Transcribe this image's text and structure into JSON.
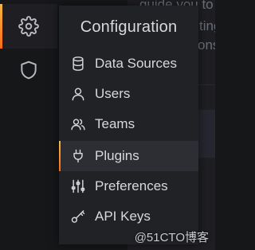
{
  "background": {
    "lines": [
      "guide you to",
      "tings",
      "onst"
    ]
  },
  "sidemenu": {
    "items": [
      {
        "icon": "gear-icon",
        "active": true
      },
      {
        "icon": "shield-icon",
        "active": false
      }
    ]
  },
  "dropdown": {
    "title": "Configuration",
    "items": [
      {
        "label": "Data Sources",
        "icon": "database-icon",
        "active": false
      },
      {
        "label": "Users",
        "icon": "user-icon",
        "active": false
      },
      {
        "label": "Teams",
        "icon": "users-icon",
        "active": false
      },
      {
        "label": "Plugins",
        "icon": "plug-icon",
        "active": true
      },
      {
        "label": "Preferences",
        "icon": "sliders-icon",
        "active": false
      },
      {
        "label": "API Keys",
        "icon": "key-icon",
        "active": false
      }
    ]
  },
  "watermark": "@51CTO博客",
  "colors": {
    "accent_top": "#f6b73c",
    "accent_bottom": "#ff6a1a",
    "menu_bg": "#202226",
    "active_bg": "#2c2e33",
    "text": "#d8d9da"
  }
}
